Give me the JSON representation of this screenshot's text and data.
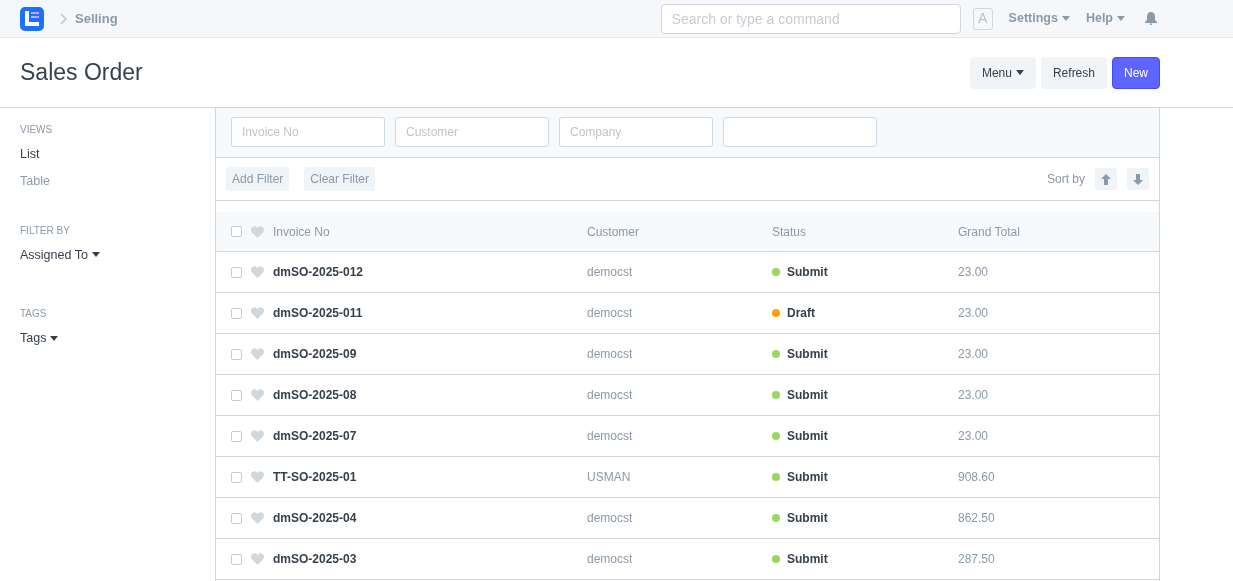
{
  "navbar": {
    "breadcrumb": "Selling",
    "search": {
      "placeholder": "Search or type a command"
    },
    "avatar": "A",
    "menus": [
      "Settings",
      "Help"
    ]
  },
  "page": {
    "title": "Sales Order",
    "buttons": [
      {
        "label": "Menu",
        "kind": "dropdown"
      },
      {
        "label": "Refresh",
        "kind": "default"
      },
      {
        "label": "New",
        "kind": "primary"
      }
    ]
  },
  "sidebar": {
    "sections": [
      {
        "heading": "VIEWS",
        "items": [
          {
            "label": "List",
            "selected": true,
            "kind": "link"
          },
          {
            "label": "Table",
            "selected": false,
            "kind": "link"
          }
        ]
      },
      {
        "heading": "FILTER BY",
        "items": [
          {
            "label": "Assigned To",
            "kind": "dropdown"
          }
        ]
      },
      {
        "heading": "TAGS",
        "items": [
          {
            "label": "Tags",
            "kind": "dropdown"
          }
        ]
      }
    ]
  },
  "filters": {
    "fields": [
      {
        "kind": "text",
        "placeholder": "Invoice No"
      },
      {
        "kind": "text",
        "placeholder": "Customer"
      },
      {
        "kind": "text",
        "placeholder": "Company"
      },
      {
        "kind": "blank"
      }
    ],
    "buttons": [
      "Add Filter",
      "Clear Filter"
    ],
    "sort_label": "Sort by"
  },
  "table": {
    "columns": [
      "Invoice No",
      "Customer",
      "Status",
      "Grand Total"
    ],
    "all_checked": false,
    "rows": [
      {
        "checked": false,
        "invoice": "dmSO-2025-012",
        "customer": "democst",
        "status": "Submit",
        "color": "#98d85b",
        "total": "23.00"
      },
      {
        "checked": false,
        "invoice": "dmSO-2025-011",
        "customer": "democst",
        "status": "Draft",
        "color": "#ffa00a",
        "total": "23.00"
      },
      {
        "checked": false,
        "invoice": "dmSO-2025-09",
        "customer": "democst",
        "status": "Submit",
        "color": "#98d85b",
        "total": "23.00"
      },
      {
        "checked": false,
        "invoice": "dmSO-2025-08",
        "customer": "democst",
        "status": "Submit",
        "color": "#98d85b",
        "total": "23.00"
      },
      {
        "checked": false,
        "invoice": "dmSO-2025-07",
        "customer": "democst",
        "status": "Submit",
        "color": "#98d85b",
        "total": "23.00"
      },
      {
        "checked": false,
        "invoice": "TT-SO-2025-01",
        "customer": "USMAN",
        "status": "Submit",
        "color": "#98d85b",
        "total": "908.60"
      },
      {
        "checked": false,
        "invoice": "dmSO-2025-04",
        "customer": "democst",
        "status": "Submit",
        "color": "#98d85b",
        "total": "862.50"
      },
      {
        "checked": false,
        "invoice": "dmSO-2025-03",
        "customer": "democst",
        "status": "Submit",
        "color": "#98d85b",
        "total": "287.50"
      }
    ]
  }
}
